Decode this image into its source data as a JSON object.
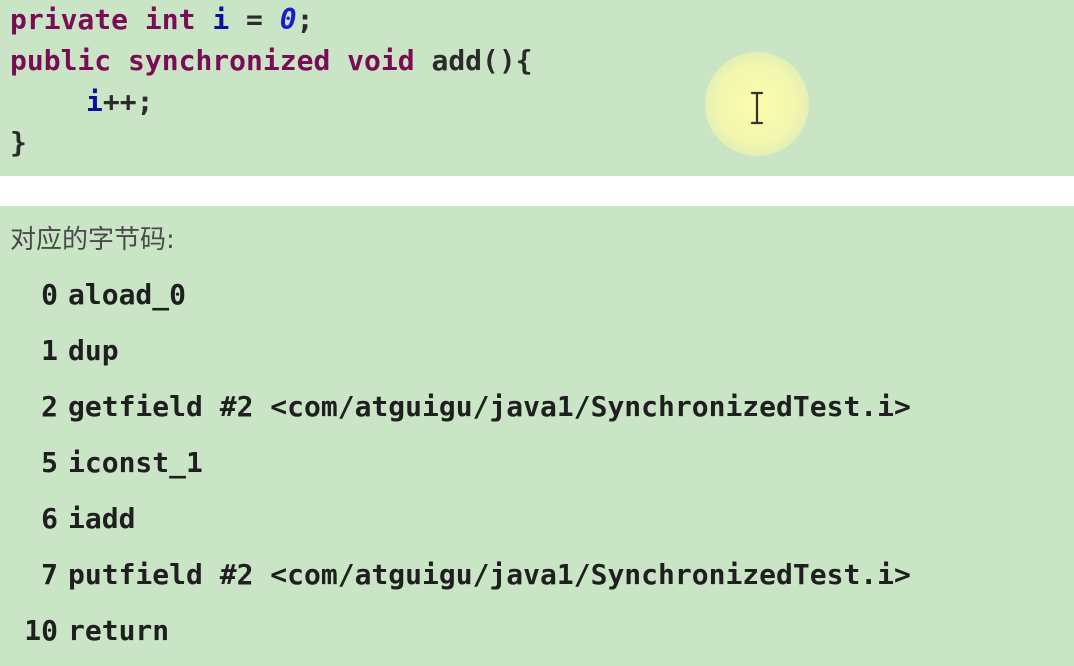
{
  "code": {
    "line1": {
      "kw1": "private",
      "kw2": "int",
      "var": "i",
      "eq": " = ",
      "num": "0",
      "end": ";"
    },
    "line2": {
      "kw1": "public",
      "kw2": "synchronized",
      "kw3": "void",
      "rest": "add(){"
    },
    "line3": {
      "var": "i",
      "rest": "++;"
    },
    "line4": {
      "rest": "}"
    }
  },
  "bytecode": {
    "heading": "对应的字节码:",
    "instructions": [
      {
        "offset": "0",
        "op": "aload_0"
      },
      {
        "offset": "1",
        "op": "dup"
      },
      {
        "offset": "2",
        "op": "getfield #2 <com/atguigu/java1/SynchronizedTest.i>"
      },
      {
        "offset": "5",
        "op": "iconst_1"
      },
      {
        "offset": "6",
        "op": "iadd"
      },
      {
        "offset": "7",
        "op": "putfield #2 <com/atguigu/java1/SynchronizedTest.i>"
      },
      {
        "offset": "10",
        "op": "return"
      }
    ]
  },
  "icons": {
    "cursor": "text-cursor-icon"
  },
  "colors": {
    "panel_bg": "#c9e5c6",
    "keyword": "#7a0b55",
    "variable": "#0d0d9e",
    "number": "#1a1ad0"
  }
}
